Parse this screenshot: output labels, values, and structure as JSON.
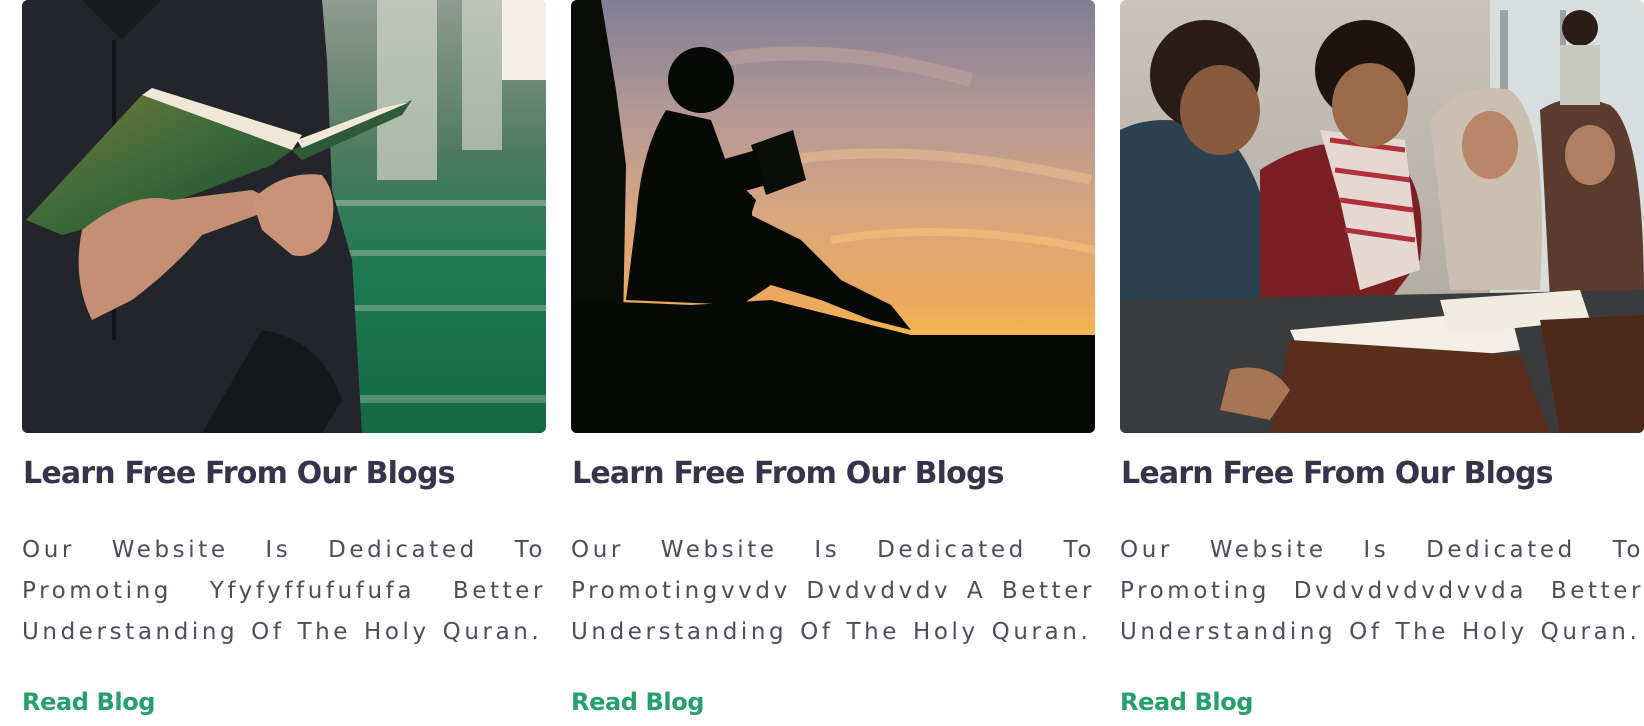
{
  "cards": [
    {
      "title": "Learn Free From Our Blogs",
      "description": "Our Website Is Dedicated To Promoting  Yfyfyffufufufa Better Understanding Of The Holy Quran.",
      "link_label": "Read Blog",
      "image": "person-reading-quran-in-mosque"
    },
    {
      "title": "Learn Free From Our Blogs",
      "description": "Our Website Is Dedicated To Promotingvvdv Dvdvdvdv A Better Understanding Of The Holy Quran.",
      "link_label": "Read Blog",
      "image": "child-silhouette-reading-at-sunset"
    },
    {
      "title": "Learn Free From Our Blogs",
      "description": "Our Website Is Dedicated To Promoting Dvdvdvdvdvvda Better Understanding Of The Holy Quran.",
      "link_label": "Read Blog",
      "image": "children-reading-quran-on-stands"
    }
  ],
  "colors": {
    "title": "#35344b",
    "body_text": "#4d4d58",
    "link": "#25a06a"
  }
}
